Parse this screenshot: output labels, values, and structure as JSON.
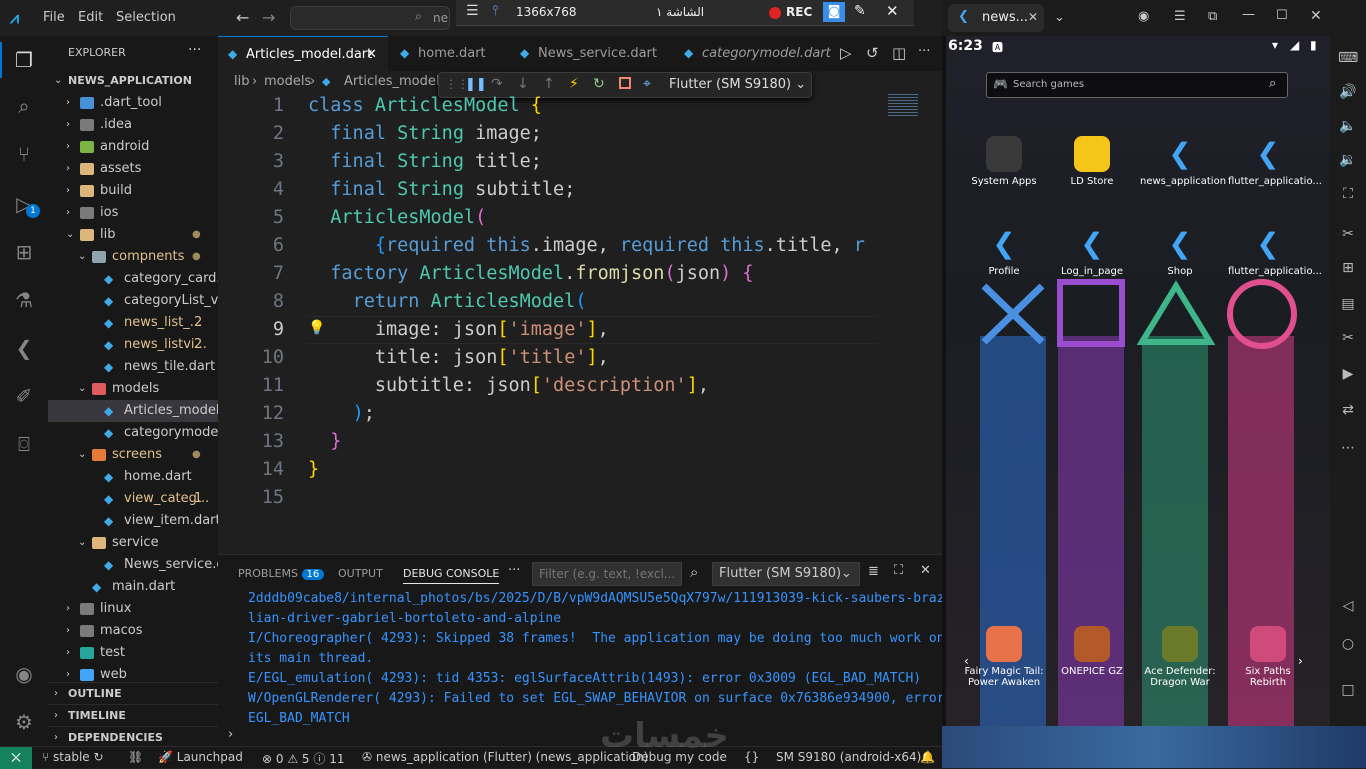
{
  "menu": {
    "file": "File",
    "edit": "Edit",
    "selection": "Selection",
    "search_partial": "ne"
  },
  "rec_toolbar": {
    "resolution": "1366x768",
    "screen_label": "الشاشة ١",
    "rec_label": "REC"
  },
  "explorer": {
    "title": "EXPLORER",
    "project": "NEWS_APPLICATION",
    "rows": [
      {
        "label": ".dart_tool",
        "badge": ""
      },
      {
        "label": ".idea",
        "badge": ""
      },
      {
        "label": "android",
        "badge": ""
      },
      {
        "label": "assets",
        "badge": ""
      },
      {
        "label": "build",
        "badge": ""
      },
      {
        "label": "ios",
        "badge": ""
      },
      {
        "label": "lib",
        "badge": ""
      },
      {
        "label": "compnents",
        "badge": ""
      },
      {
        "label": "category_card....",
        "badge": ""
      },
      {
        "label": "categoryList_vi...",
        "badge": ""
      },
      {
        "label": "news_list_...",
        "badge": "2"
      },
      {
        "label": "news_listvi...",
        "badge": "2"
      },
      {
        "label": "news_tile.dart",
        "badge": ""
      },
      {
        "label": "models",
        "badge": ""
      },
      {
        "label": "Articles_model....",
        "badge": ""
      },
      {
        "label": "categorymodel....",
        "badge": ""
      },
      {
        "label": "screens",
        "badge": ""
      },
      {
        "label": "home.dart",
        "badge": ""
      },
      {
        "label": "view_categ...",
        "badge": "1"
      },
      {
        "label": "view_item.dart",
        "badge": ""
      },
      {
        "label": "service",
        "badge": ""
      },
      {
        "label": "News_service.d...",
        "badge": ""
      },
      {
        "label": "main.dart",
        "badge": ""
      },
      {
        "label": "linux",
        "badge": ""
      },
      {
        "label": "macos",
        "badge": ""
      },
      {
        "label": "test",
        "badge": ""
      },
      {
        "label": "web",
        "badge": ""
      }
    ],
    "outline": "OUTLINE",
    "timeline": "TIMELINE",
    "dependencies": "DEPENDENCIES"
  },
  "tabs": [
    {
      "label": "Articles_model.dart"
    },
    {
      "label": "home.dart"
    },
    {
      "label": "News_service.dart"
    },
    {
      "label": "categorymodel.dart"
    }
  ],
  "breadcrumb": {
    "lib": "lib",
    "models": "models",
    "file": "Articles_model.d"
  },
  "debug_toolbar": {
    "device": "Flutter (SM S9180)"
  },
  "code": {
    "line_numbers": [
      "1",
      "2",
      "3",
      "4",
      "5",
      "6",
      "7",
      "8",
      "9",
      "10",
      "11",
      "12",
      "13",
      "14",
      "15"
    ]
  },
  "panel": {
    "problems": "PROBLEMS",
    "problems_count": "16",
    "output": "OUTPUT",
    "debug_console": "DEBUG CONSOLE",
    "filter_placeholder": "Filter (e.g. text, !excl...",
    "device": "Flutter (SM S9180)",
    "console_lines": [
      "2dddb09cabe8/internal_photos/bs/2025/D/B/vpW9dAQMSU5e5QqX797w/111913039-kick-saubers-brazi",
      "lian-driver-gabriel-bortoleto-and-alpine",
      "I/Choreographer( 4293): Skipped 38 frames!  The application may be doing too much work on",
      "its main thread.",
      "E/EGL_emulation( 4293): tid 4353: eglSurfaceAttrib(1493): error 0x3009 (EGL_BAD_MATCH)",
      "W/OpenGLRenderer( 4293): Failed to set EGL_SWAP_BEHAVIOR on surface 0x76386e934900, error=",
      "EGL_BAD_MATCH"
    ]
  },
  "status": {
    "branch": "stable",
    "launchpad": "Launchpad",
    "errors": "0",
    "warnings": "5",
    "infos": "11",
    "app": "news_application (Flutter) (news_application)",
    "debug_code": "Debug my code",
    "device": "SM S9180 (android-x64)"
  },
  "emulator": {
    "tab_title": "news...",
    "time": "6:23",
    "search_placeholder": "Search games",
    "apps_row1": [
      "System Apps",
      "LD Store",
      "news_application",
      "flutter_applicatio..."
    ],
    "apps_row2": [
      "Profile",
      "Log_in_page",
      "Shop",
      "flutter_applicatio..."
    ],
    "games": [
      "Fairy Magic Tail: Power Awaken",
      "ONEPICE GZ",
      "Ace Defender: Dragon War",
      "Six Paths Rebirth"
    ]
  },
  "watermark": "خمسات",
  "colors": {
    "accent": "#0078d4",
    "debug_status": "#cc6633",
    "badge": "#0078d4"
  }
}
